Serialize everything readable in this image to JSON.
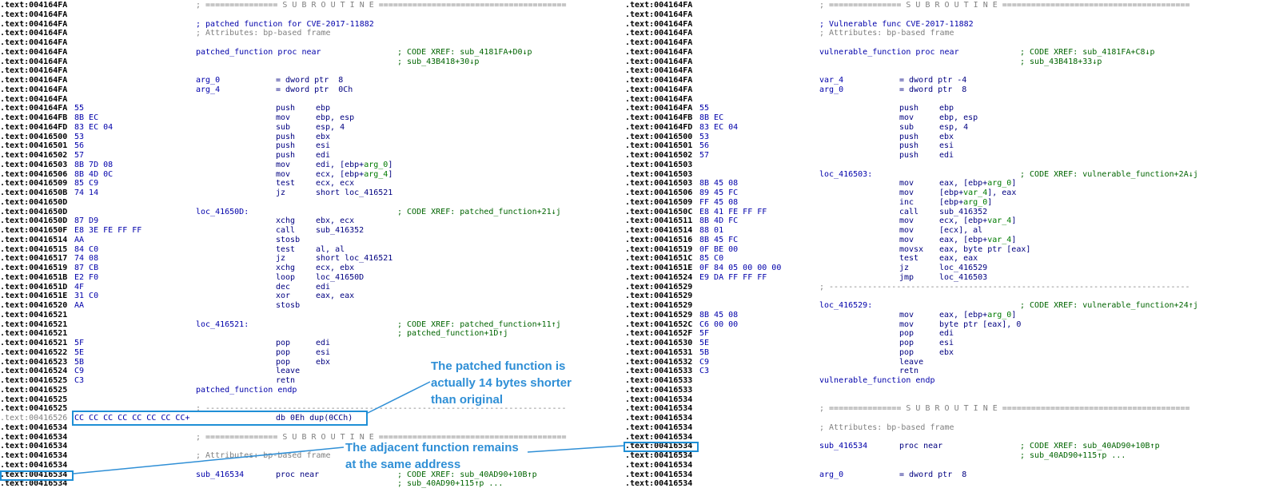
{
  "colors": {
    "annotation": "#2f8fd6",
    "box": "#1f8fd6",
    "address": "#000000",
    "bytes": "#0000aa",
    "comment": "#006400",
    "local_var": "#007a00"
  },
  "left_listing": [
    {
      "a": ".text:004164FA",
      "c": "; =============== S U B R O U T I N E =======================================",
      "cc": "cmtg"
    },
    {
      "a": ".text:004164FA"
    },
    {
      "a": ".text:004164FA",
      "c": "; patched function for CVE-2017-11882",
      "cc": "lbl"
    },
    {
      "a": ".text:004164FA",
      "c": "; Attributes: bp-based frame",
      "cc": "cmtg"
    },
    {
      "a": ".text:004164FA"
    },
    {
      "a": ".text:004164FA",
      "l": "patched_function proc near",
      "c": "; CODE XREF: sub_4181FA+D0↓p"
    },
    {
      "a": ".text:004164FA",
      "c": "; sub_43B418+30↓p"
    },
    {
      "a": ".text:004164FA"
    },
    {
      "a": ".text:004164FA",
      "l": "arg_0",
      "m": "= dword ptr  8"
    },
    {
      "a": ".text:004164FA",
      "l": "arg_4",
      "m": "= dword ptr  0Ch"
    },
    {
      "a": ".text:004164FA"
    },
    {
      "a": ".text:004164FA",
      "b": "55",
      "m": "push",
      "o": "ebp"
    },
    {
      "a": ".text:004164FB",
      "b": "8B EC",
      "m": "mov",
      "o": "ebp, esp"
    },
    {
      "a": ".text:004164FD",
      "b": "83 EC 04",
      "m": "sub",
      "o": "esp, 4"
    },
    {
      "a": ".text:00416500",
      "b": "53",
      "m": "push",
      "o": "ebx"
    },
    {
      "a": ".text:00416501",
      "b": "56",
      "m": "push",
      "o": "esi"
    },
    {
      "a": ".text:00416502",
      "b": "57",
      "m": "push",
      "o": "edi"
    },
    {
      "a": ".text:00416503",
      "b": "8B 7D 08",
      "m": "mov",
      "o": "edi, [ebp+arg_0]"
    },
    {
      "a": ".text:00416506",
      "b": "8B 4D 0C",
      "m": "mov",
      "o": "ecx, [ebp+arg_4]"
    },
    {
      "a": ".text:00416509",
      "b": "85 C9",
      "m": "test",
      "o": "ecx, ecx"
    },
    {
      "a": ".text:0041650B",
      "b": "74 14",
      "m": "jz",
      "o": "short loc_416521"
    },
    {
      "a": ".text:0041650D"
    },
    {
      "a": ".text:0041650D",
      "l": "loc_41650D:",
      "c": "; CODE XREF: patched_function+21↓j"
    },
    {
      "a": ".text:0041650D",
      "b": "87 D9",
      "m": "xchg",
      "o": "ebx, ecx"
    },
    {
      "a": ".text:0041650F",
      "b": "E8 3E FE FF FF",
      "m": "call",
      "o": "sub_416352"
    },
    {
      "a": ".text:00416514",
      "b": "AA",
      "m": "stosb",
      "o": ""
    },
    {
      "a": ".text:00416515",
      "b": "84 C0",
      "m": "test",
      "o": "al, al"
    },
    {
      "a": ".text:00416517",
      "b": "74 08",
      "m": "jz",
      "o": "short loc_416521"
    },
    {
      "a": ".text:00416519",
      "b": "87 CB",
      "m": "xchg",
      "o": "ecx, ebx"
    },
    {
      "a": ".text:0041651B",
      "b": "E2 F0",
      "m": "loop",
      "o": "loc_41650D"
    },
    {
      "a": ".text:0041651D",
      "b": "4F",
      "m": "dec",
      "o": "edi"
    },
    {
      "a": ".text:0041651E",
      "b": "31 C0",
      "m": "xor",
      "o": "eax, eax"
    },
    {
      "a": ".text:00416520",
      "b": "AA",
      "m": "stosb",
      "o": ""
    },
    {
      "a": ".text:00416521"
    },
    {
      "a": ".text:00416521",
      "l": "loc_416521:",
      "c": "; CODE XREF: patched_function+11↑j"
    },
    {
      "a": ".text:00416521",
      "c": "; patched_function+1D↑j"
    },
    {
      "a": ".text:00416521",
      "b": "5F",
      "m": "pop",
      "o": "edi"
    },
    {
      "a": ".text:00416522",
      "b": "5E",
      "m": "pop",
      "o": "esi"
    },
    {
      "a": ".text:00416523",
      "b": "5B",
      "m": "pop",
      "o": "ebx"
    },
    {
      "a": ".text:00416524",
      "b": "C9",
      "m": "leave",
      "o": ""
    },
    {
      "a": ".text:00416525",
      "b": "C3",
      "m": "retn",
      "o": ""
    },
    {
      "a": ".text:00416525",
      "l": "patched_function endp"
    },
    {
      "a": ".text:00416525"
    },
    {
      "a": ".text:00416525",
      "c": "; ---------------------------------------------------------------------------",
      "cc": "cmtg"
    },
    {
      "a": ".text:00416526",
      "b": "CC CC CC CC CC CC CC CC+",
      "m": "db 0Eh dup(0CCh)",
      "dim": true
    },
    {
      "a": ".text:00416534"
    },
    {
      "a": ".text:00416534",
      "c": "; =============== S U B R O U T I N E =======================================",
      "cc": "cmtg"
    },
    {
      "a": ".text:00416534"
    },
    {
      "a": ".text:00416534",
      "c": "; Attributes: bp-based frame",
      "cc": "cmtg"
    },
    {
      "a": ".text:00416534"
    },
    {
      "a": ".text:00416534",
      "l": "sub_416534",
      "m": "proc near",
      "c": "; CODE XREF: sub_40AD90+10B↑p"
    },
    {
      "a": ".text:00416534",
      "c": "; sub_40AD90+115↑p ..."
    }
  ],
  "right_listing": [
    {
      "a": ".text:004164FA",
      "c": "; =============== S U B R O U T I N E =======================================",
      "cc": "cmtg"
    },
    {
      "a": ".text:004164FA"
    },
    {
      "a": ".text:004164FA",
      "c": "; Vulnerable func CVE-2017-11882",
      "cc": "lbl"
    },
    {
      "a": ".text:004164FA",
      "c": "; Attributes: bp-based frame",
      "cc": "cmtg"
    },
    {
      "a": ".text:004164FA"
    },
    {
      "a": ".text:004164FA",
      "l": "vulnerable_function proc near",
      "c": "; CODE XREF: sub_4181FA+C8↓p"
    },
    {
      "a": ".text:004164FA",
      "c": "; sub_43B418+33↓p"
    },
    {
      "a": ".text:004164FA"
    },
    {
      "a": ".text:004164FA",
      "l": "var_4",
      "m": "= dword ptr -4"
    },
    {
      "a": ".text:004164FA",
      "l": "arg_0",
      "m": "= dword ptr  8"
    },
    {
      "a": ".text:004164FA"
    },
    {
      "a": ".text:004164FA",
      "b": "55",
      "m": "push",
      "o": "ebp"
    },
    {
      "a": ".text:004164FB",
      "b": "8B EC",
      "m": "mov",
      "o": "ebp, esp"
    },
    {
      "a": ".text:004164FD",
      "b": "83 EC 04",
      "m": "sub",
      "o": "esp, 4"
    },
    {
      "a": ".text:00416500",
      "b": "53",
      "m": "push",
      "o": "ebx"
    },
    {
      "a": ".text:00416501",
      "b": "56",
      "m": "push",
      "o": "esi"
    },
    {
      "a": ".text:00416502",
      "b": "57",
      "m": "push",
      "o": "edi"
    },
    {
      "a": ".text:00416503"
    },
    {
      "a": ".text:00416503",
      "l": "loc_416503:",
      "c": "; CODE XREF: vulnerable_function+2A↓j"
    },
    {
      "a": ".text:00416503",
      "b": "8B 45 08",
      "m": "mov",
      "o": "eax, [ebp+arg_0]"
    },
    {
      "a": ".text:00416506",
      "b": "89 45 FC",
      "m": "mov",
      "o": "[ebp+var_4], eax"
    },
    {
      "a": ".text:00416509",
      "b": "FF 45 08",
      "m": "inc",
      "o": "[ebp+arg_0]"
    },
    {
      "a": ".text:0041650C",
      "b": "E8 41 FE FF FF",
      "m": "call",
      "o": "sub_416352"
    },
    {
      "a": ".text:00416511",
      "b": "8B 4D FC",
      "m": "mov",
      "o": "ecx, [ebp+var_4]"
    },
    {
      "a": ".text:00416514",
      "b": "88 01",
      "m": "mov",
      "o": "[ecx], al"
    },
    {
      "a": ".text:00416516",
      "b": "8B 45 FC",
      "m": "mov",
      "o": "eax, [ebp+var_4]"
    },
    {
      "a": ".text:00416519",
      "b": "0F BE 00",
      "m": "movsx",
      "o": "eax, byte ptr [eax]"
    },
    {
      "a": ".text:0041651C",
      "b": "85 C0",
      "m": "test",
      "o": "eax, eax"
    },
    {
      "a": ".text:0041651E",
      "b": "0F 84 05 00 00 00",
      "m": "jz",
      "o": "loc_416529"
    },
    {
      "a": ".text:00416524",
      "b": "E9 DA FF FF FF",
      "m": "jmp",
      "o": "loc_416503"
    },
    {
      "a": ".text:00416529",
      "c": "; ---------------------------------------------------------------------------",
      "cc": "cmtg"
    },
    {
      "a": ".text:00416529"
    },
    {
      "a": ".text:00416529",
      "l": "loc_416529:",
      "c": "; CODE XREF: vulnerable_function+24↑j"
    },
    {
      "a": ".text:00416529",
      "b": "8B 45 08",
      "m": "mov",
      "o": "eax, [ebp+arg_0]"
    },
    {
      "a": ".text:0041652C",
      "b": "C6 00 00",
      "m": "mov",
      "o": "byte ptr [eax], 0"
    },
    {
      "a": ".text:0041652F",
      "b": "5F",
      "m": "pop",
      "o": "edi"
    },
    {
      "a": ".text:00416530",
      "b": "5E",
      "m": "pop",
      "o": "esi"
    },
    {
      "a": ".text:00416531",
      "b": "5B",
      "m": "pop",
      "o": "ebx"
    },
    {
      "a": ".text:00416532",
      "b": "C9",
      "m": "leave",
      "o": ""
    },
    {
      "a": ".text:00416533",
      "b": "C3",
      "m": "retn",
      "o": ""
    },
    {
      "a": ".text:00416533",
      "l": "vulnerable_function endp"
    },
    {
      "a": ".text:00416533"
    },
    {
      "a": ".text:00416534"
    },
    {
      "a": ".text:00416534",
      "c": "; =============== S U B R O U T I N E =======================================",
      "cc": "cmtg"
    },
    {
      "a": ".text:00416534"
    },
    {
      "a": ".text:00416534",
      "c": "; Attributes: bp-based frame",
      "cc": "cmtg"
    },
    {
      "a": ".text:00416534"
    },
    {
      "a": ".text:00416534",
      "l": "sub_416534",
      "m": "proc near",
      "c": "; CODE XREF: sub_40AD90+10B↑p"
    },
    {
      "a": ".text:00416534",
      "c": "; sub_40AD90+115↑p ..."
    },
    {
      "a": ".text:00416534"
    },
    {
      "a": ".text:00416534",
      "l": "arg_0",
      "m": "= dword ptr  8"
    },
    {
      "a": ".text:00416534"
    }
  ],
  "annotations": {
    "patched_note": [
      "The patched function is",
      "actually 14 bytes shorter",
      "than original"
    ],
    "adjacent_note": [
      "The adjacent function remains",
      "at the same address"
    ]
  }
}
